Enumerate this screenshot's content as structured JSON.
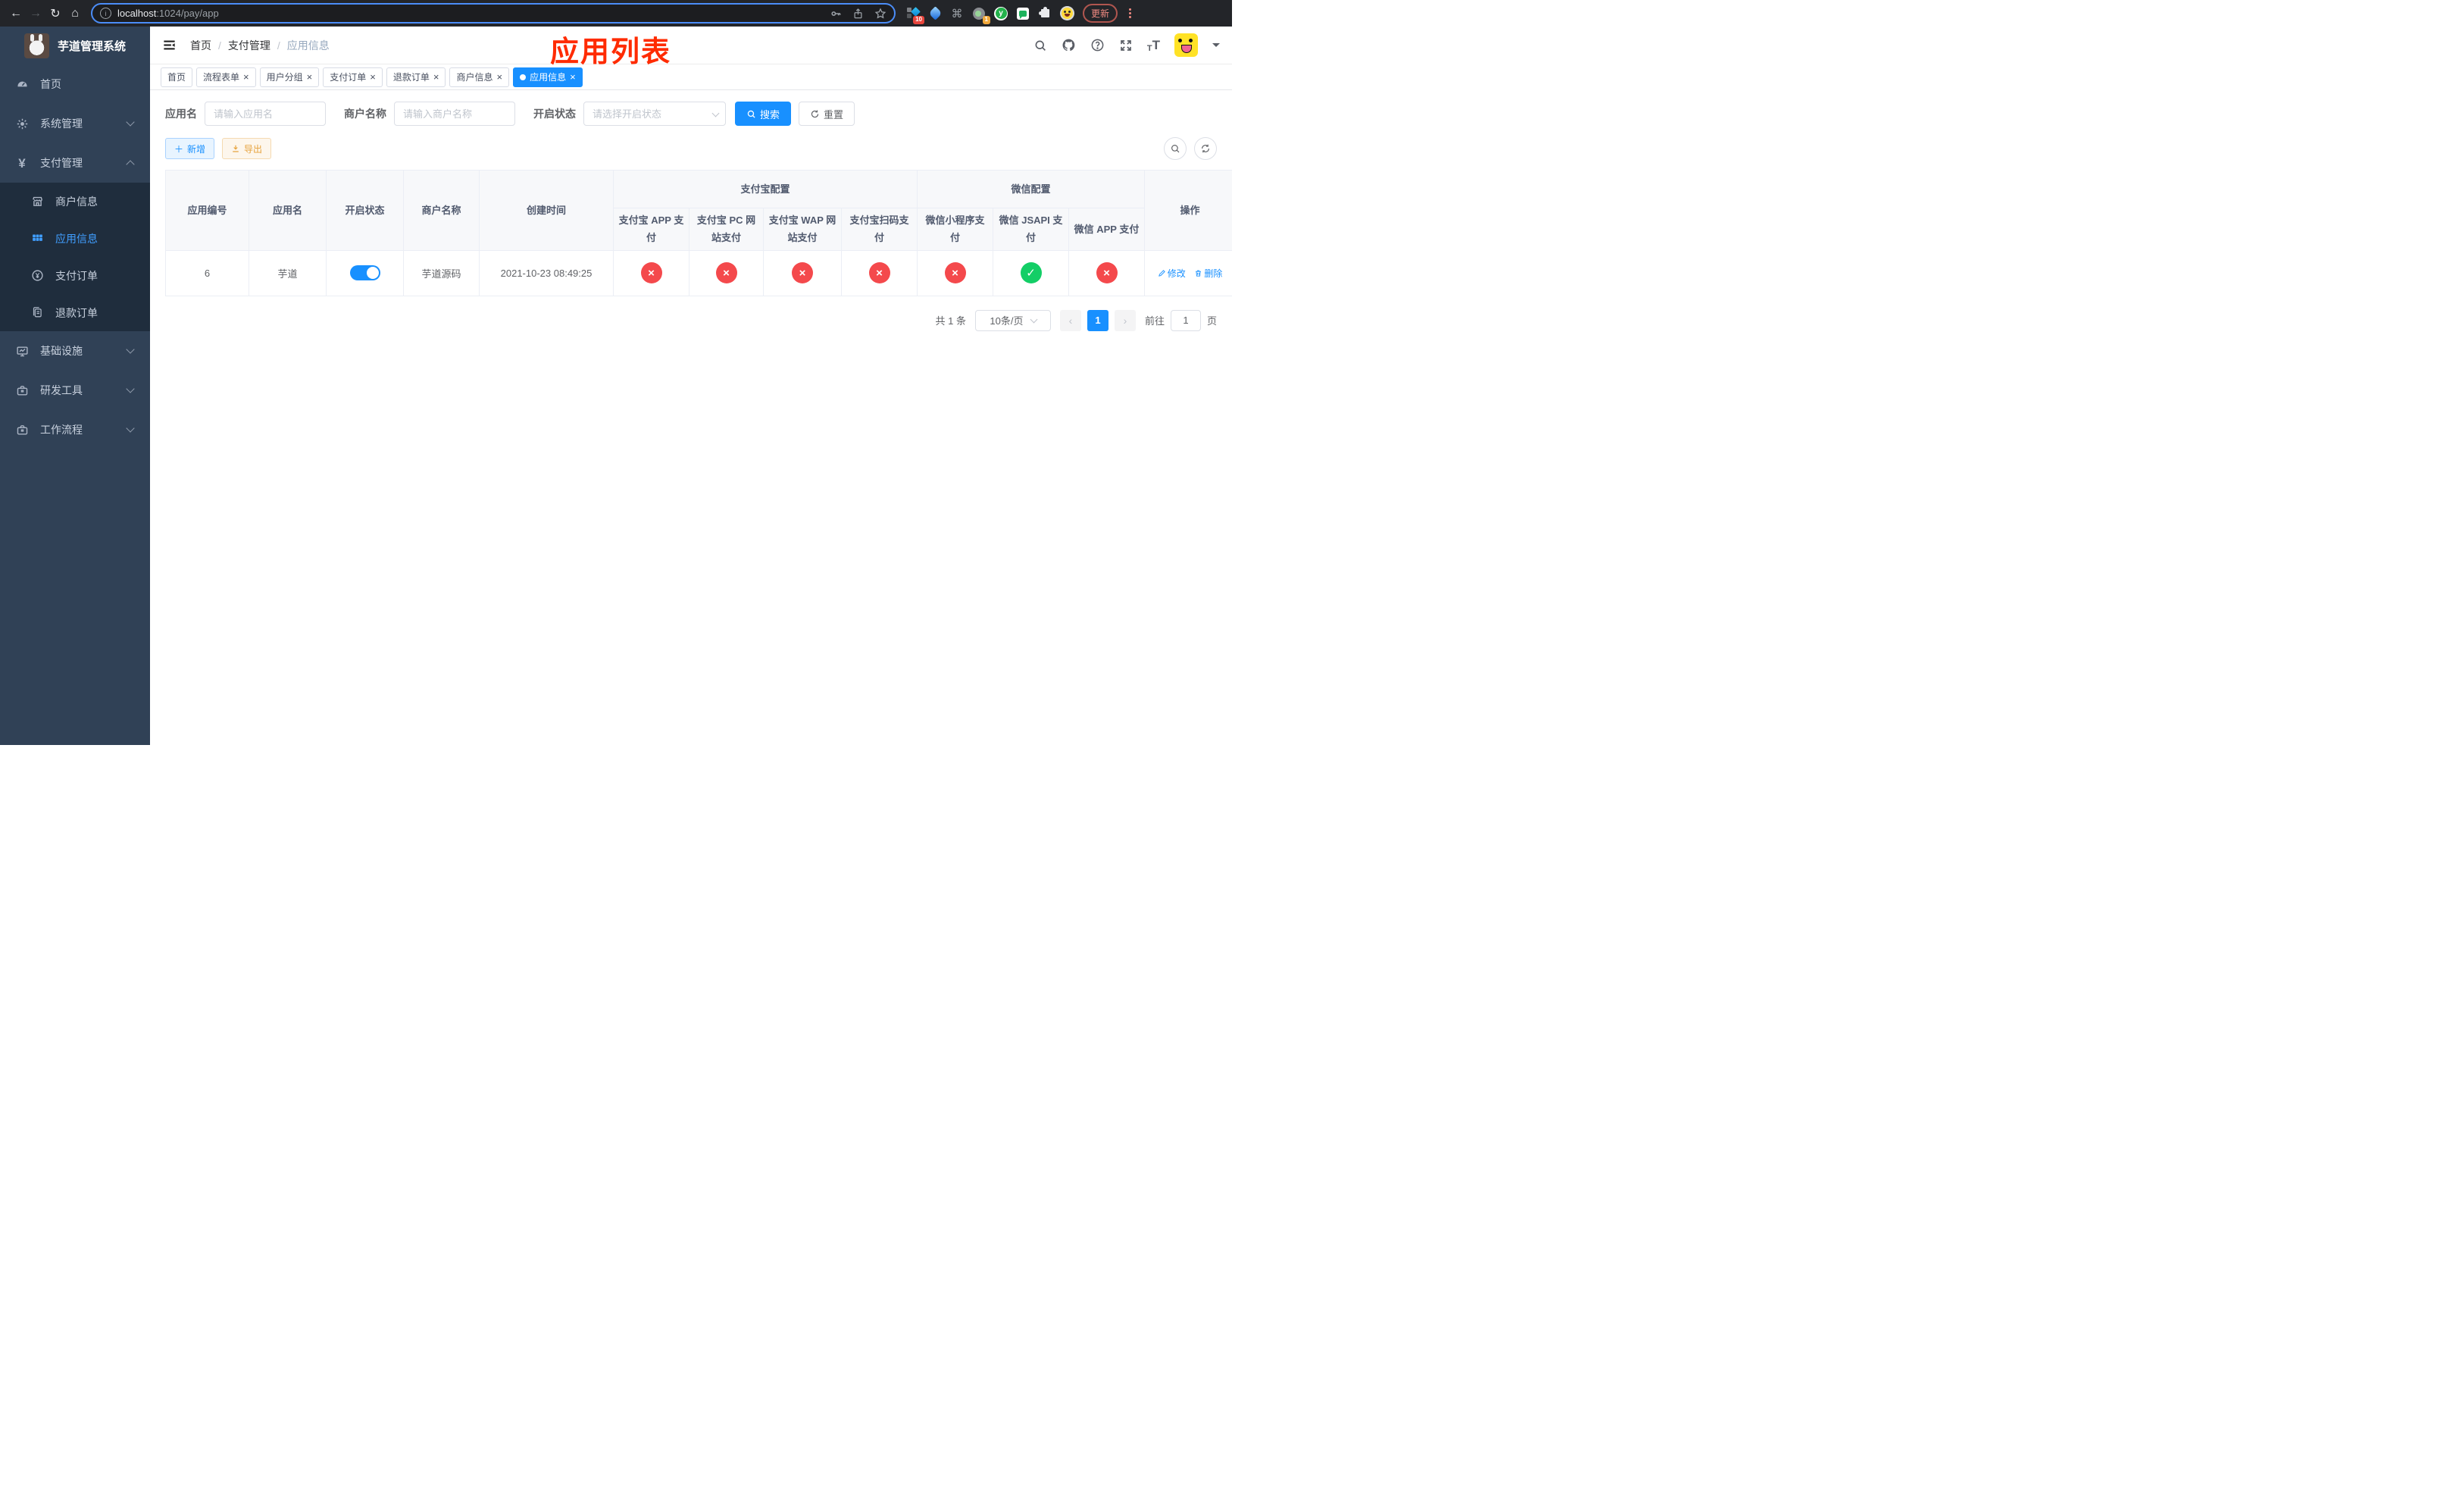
{
  "browser": {
    "url_host": "localhost",
    "url_path": ":1024/pay/app",
    "update_label": "更新",
    "ext_badge_10": "10",
    "ext_badge_1": "1",
    "ext_y": "y"
  },
  "sidebar": {
    "title": "芋道管理系统",
    "menu": [
      {
        "label": "首页"
      },
      {
        "label": "系统管理"
      },
      {
        "label": "支付管理"
      },
      {
        "label": "基础设施"
      },
      {
        "label": "研发工具"
      },
      {
        "label": "工作流程"
      }
    ],
    "submenu": [
      {
        "label": "商户信息"
      },
      {
        "label": "应用信息"
      },
      {
        "label": "支付订单"
      },
      {
        "label": "退款订单"
      }
    ]
  },
  "header": {
    "breadcrumb": {
      "home": "首页",
      "section": "支付管理",
      "current": "应用信息",
      "separator": "/"
    },
    "annotation": "应用列表"
  },
  "tags": [
    {
      "label": "首页"
    },
    {
      "label": "流程表单"
    },
    {
      "label": "用户分组"
    },
    {
      "label": "支付订单"
    },
    {
      "label": "退款订单"
    },
    {
      "label": "商户信息"
    },
    {
      "label": "应用信息"
    }
  ],
  "filter": {
    "app_name_label": "应用名",
    "app_name_placeholder": "请输入应用名",
    "merchant_label": "商户名称",
    "merchant_placeholder": "请输入商户名称",
    "status_label": "开启状态",
    "status_placeholder": "请选择开启状态",
    "search_label": "搜索",
    "reset_label": "重置"
  },
  "toolbar": {
    "add_label": "新增",
    "export_label": "导出"
  },
  "table": {
    "cols": {
      "app_no": "应用编号",
      "app_name": "应用名",
      "status": "开启状态",
      "merchant": "商户名称",
      "created": "创建时间",
      "actions": "操作"
    },
    "groups": {
      "alipay": "支付宝配置",
      "wechat": "微信配置"
    },
    "alipay_cols": [
      "支付宝 APP 支付",
      "支付宝 PC 网站支付",
      "支付宝 WAP 网站支付",
      "支付宝扫码支付"
    ],
    "wechat_cols": [
      "微信小程序支付",
      "微信 JSAPI 支付",
      "微信 APP 支付"
    ],
    "row": {
      "app_no": "6",
      "app_name": "芋道",
      "enabled": true,
      "merchant": "芋道源码",
      "created": "2021-10-23 08:49:25",
      "statuses": [
        "no",
        "no",
        "no",
        "no",
        "no",
        "yes",
        "no"
      ],
      "edit_label": "修改",
      "delete_label": "删除"
    }
  },
  "pagination": {
    "total": "共 1 条",
    "page_size": "10条/页",
    "page": "1",
    "goto_label": "前往",
    "goto_value": "1",
    "page_unit": "页"
  },
  "icons": {
    "check": "✓",
    "cross": "×"
  },
  "colors": {
    "primary": "#1890ff",
    "sidebar_active": "#409eff",
    "danger": "#f4494c",
    "success": "#13ce66",
    "annotation": "#ff2b00"
  }
}
